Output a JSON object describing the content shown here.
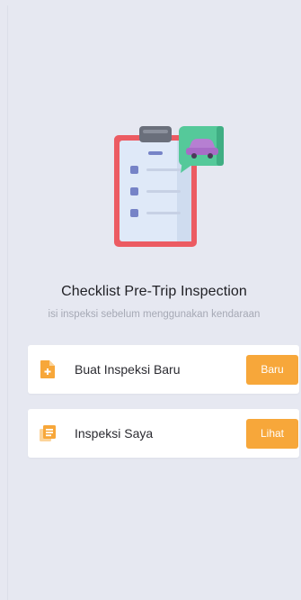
{
  "header": {
    "title": "Checklist Pre-Trip Inspection",
    "subtitle": "isi inspeksi sebelum menggunakan kendaraan"
  },
  "cards": [
    {
      "label": "Buat Inspeksi Baru",
      "button_label": "Baru",
      "icon": "add-document-icon"
    },
    {
      "label": "Inspeksi Saya",
      "button_label": "Lihat",
      "icon": "document-list-icon"
    }
  ],
  "colors": {
    "background": "#e6e8f1",
    "accent": "#f7a73a",
    "clipboard_frame": "#ec5b62",
    "car_bubble": "#55c99a"
  }
}
